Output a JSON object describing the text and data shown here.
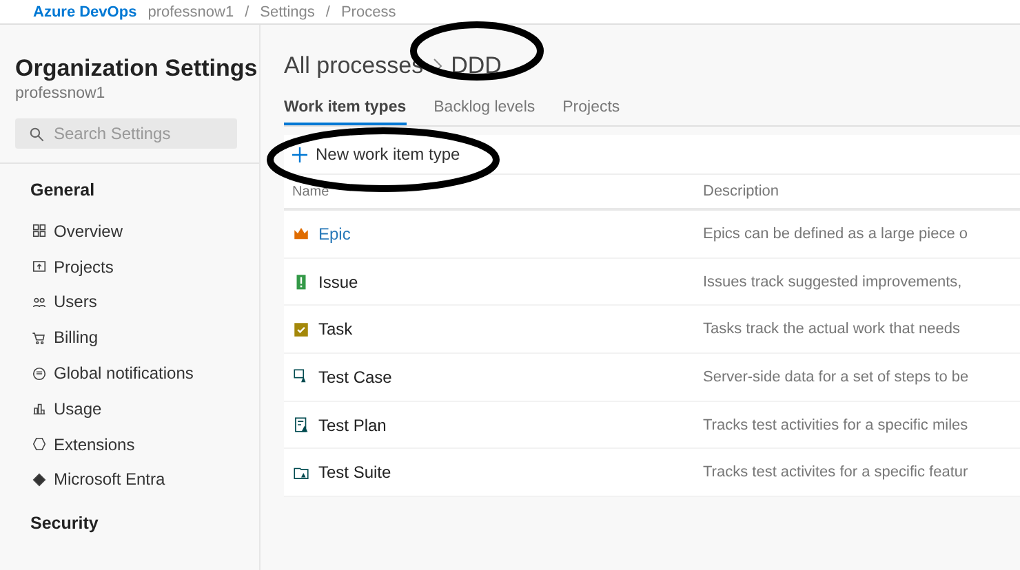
{
  "top_bar": {
    "product": "Azure DevOps",
    "breadcrumbs": [
      {
        "label": "professnow1"
      },
      {
        "separator": "/",
        "label": "Settings"
      },
      {
        "separator": "/",
        "label": "Process"
      }
    ]
  },
  "sidebar": {
    "title": "Organization Settings",
    "subtitle": "professnow1",
    "search": {
      "placeholder": "Search Settings"
    },
    "sections": [
      {
        "heading": "General",
        "items": [
          {
            "label": "Overview"
          },
          {
            "label": "Projects"
          },
          {
            "label": "Users"
          },
          {
            "label": "Billing"
          },
          {
            "label": "Global notifications"
          },
          {
            "label": "Usage"
          },
          {
            "label": "Extensions"
          },
          {
            "label": "Microsoft Entra"
          }
        ]
      },
      {
        "heading": "Security"
      }
    ]
  },
  "header": {
    "breadcrumb": [
      "All processes",
      "DDD"
    ]
  },
  "tabs": [
    {
      "label": "Work item types",
      "selected": true
    },
    {
      "label": "Backlog levels",
      "selected": false
    },
    {
      "label": "Projects",
      "selected": false
    }
  ],
  "toolbar": {
    "new_button": "New work item type"
  },
  "table": {
    "columns": [
      "Name",
      "Description"
    ],
    "rows": [
      {
        "name": "Epic",
        "link": true,
        "description": "Epics can be defined as a large piece o"
      },
      {
        "name": "Issue",
        "link": false,
        "description": "Issues track suggested improvements,"
      },
      {
        "name": "Task",
        "link": false,
        "description": "Tasks track the actual work that needs"
      },
      {
        "name": "Test Case",
        "link": false,
        "description": "Server-side data for a set of steps to be"
      },
      {
        "name": "Test Plan",
        "link": false,
        "description": "Tracks test activities for a specific miles"
      },
      {
        "name": "Test Suite",
        "link": false,
        "description": "Tracks test activites for a specific featur"
      }
    ]
  }
}
